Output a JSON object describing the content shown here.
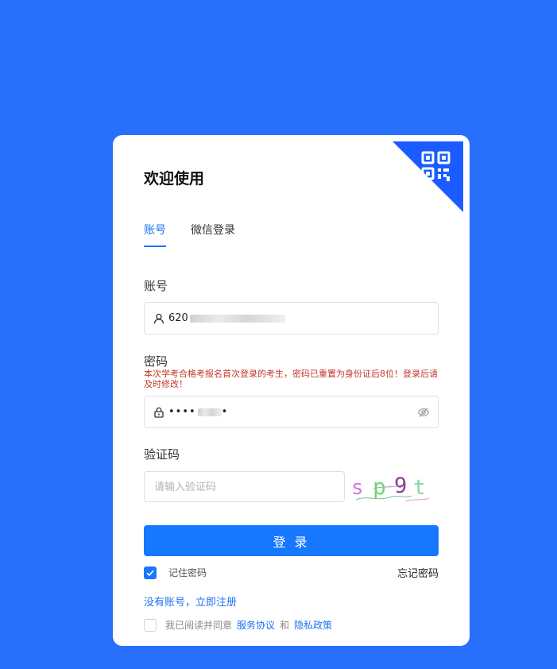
{
  "colors": {
    "background": "#2870fc",
    "accent": "#1677ff",
    "notice": "#c0392b"
  },
  "card": {
    "title": "欢迎使用",
    "qr_icon": "qr-code-icon"
  },
  "tabs": [
    {
      "label": "账号",
      "active": true
    },
    {
      "label": "微信登录",
      "active": false
    }
  ],
  "account": {
    "label": "账号",
    "value_prefix": "620",
    "icon": "user-icon"
  },
  "password": {
    "label": "密码",
    "notice": "本次学考合格考报名首次登录的考生，密码已重置为身份证后8位！登录后请及时修改！",
    "masked_value": "••••",
    "masked_tail": "•",
    "icon": "lock-icon",
    "toggle_icon": "eye-off-icon"
  },
  "captcha": {
    "label": "验证码",
    "placeholder": "请输入验证码",
    "image_text": "sp9t"
  },
  "login_button": "登 录",
  "remember": {
    "label": "记住密码",
    "checked": true
  },
  "forgot": "忘记密码",
  "register": "没有账号，立即注册",
  "agreement": {
    "prefix": "我已阅读并同意",
    "terms": "服务协议",
    "and": "和",
    "privacy": "隐私政策",
    "checked": false
  }
}
